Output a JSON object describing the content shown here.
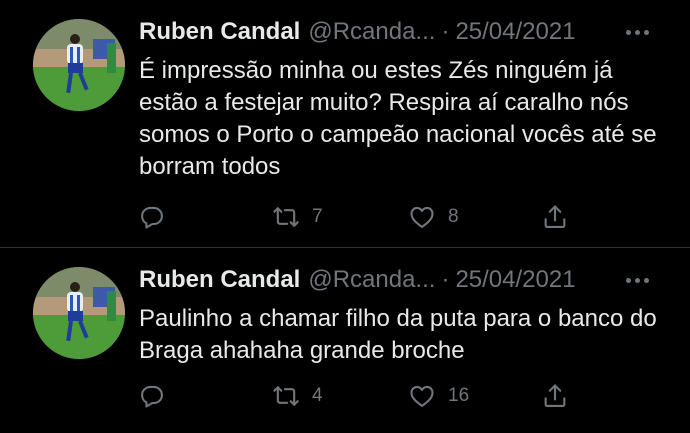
{
  "tweets": [
    {
      "author_name": "Ruben Candal",
      "handle": "@Rcanda...",
      "separator": "·",
      "date": "25/04/2021",
      "text": "É impressão minha ou estes Zés ninguém já estão a festejar muito? Respira aí caralho nós somos o Porto o campeão nacional vocês até se borram todos",
      "retweets": "7",
      "likes": "8"
    },
    {
      "author_name": "Ruben Candal",
      "handle": "@Rcanda...",
      "separator": "·",
      "date": "25/04/2021",
      "text": "Paulinho a chamar filho da puta para o banco do Braga ahahaha grande broche",
      "retweets": "4",
      "likes": "16"
    }
  ],
  "icons": {
    "reply": "reply-icon",
    "retweet": "retweet-icon",
    "like": "heart-icon",
    "share": "share-icon",
    "more": "more-icon"
  },
  "colors": {
    "background": "#000000",
    "text_primary": "#e7e9ea",
    "text_secondary": "#71767b",
    "divider": "#2f3336"
  }
}
